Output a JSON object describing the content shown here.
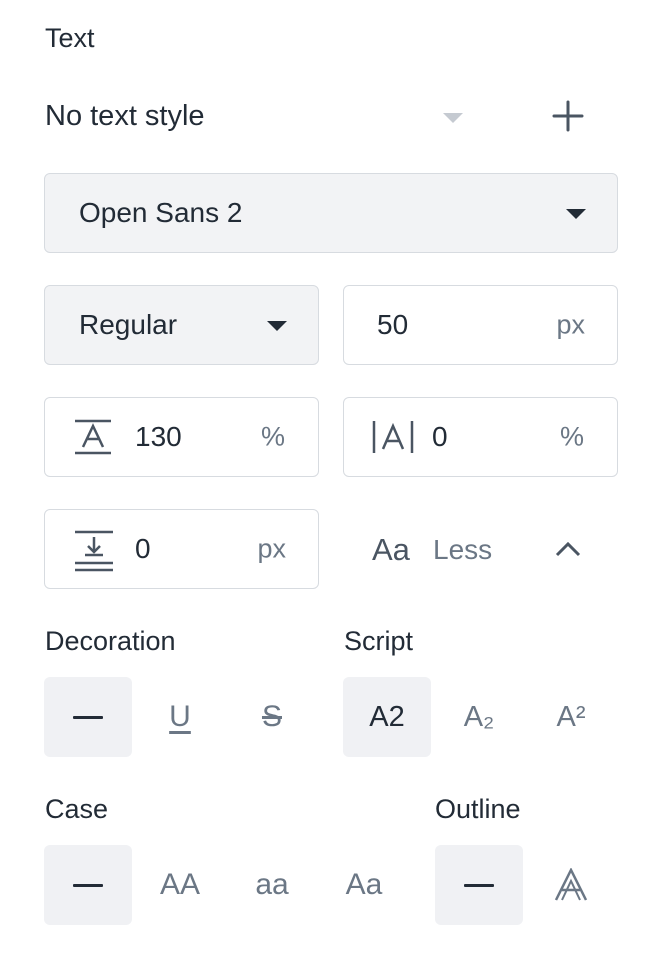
{
  "section": {
    "title": "Text"
  },
  "text_style": {
    "value": "No text style"
  },
  "font_family": {
    "value": "Open Sans 2"
  },
  "font_weight": {
    "value": "Regular"
  },
  "font_size": {
    "value": "50",
    "unit": "px"
  },
  "line_height": {
    "value": "130",
    "unit": "%"
  },
  "letter_spacing": {
    "value": "0",
    "unit": "%"
  },
  "paragraph_spacing": {
    "value": "0",
    "unit": "px"
  },
  "toggle": {
    "glyph": "Aa",
    "label": "Less"
  },
  "decoration": {
    "title": "Decoration",
    "options": [
      "",
      "U",
      "S"
    ]
  },
  "script": {
    "title": "Script",
    "options": [
      "A2",
      "A₂",
      "A²"
    ]
  },
  "case": {
    "title": "Case",
    "options": [
      "",
      "AA",
      "aa",
      "Aa"
    ]
  },
  "outline": {
    "title": "Outline",
    "options": [
      "",
      "A"
    ]
  },
  "colors": {
    "text": "#222b36",
    "muted": "#6b7785",
    "border": "#d7dbe0",
    "fill": "#f2f3f5"
  }
}
